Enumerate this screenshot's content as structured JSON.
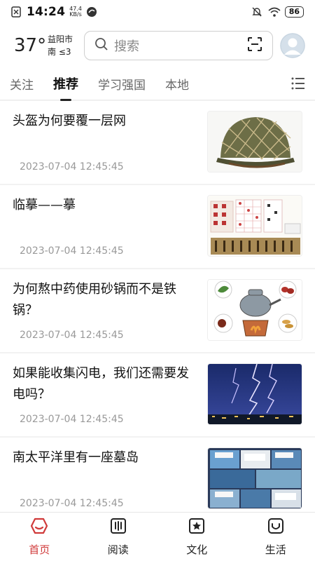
{
  "status_bar": {
    "time": "14:24",
    "net_speed_value": "47.4",
    "net_speed_unit": "KB/s",
    "battery": "86"
  },
  "header": {
    "temperature": "37°",
    "city": "益阳市",
    "wind": "南  ≤3",
    "search_placeholder": "搜索"
  },
  "tabs": [
    {
      "label": "关注"
    },
    {
      "label": "推荐"
    },
    {
      "label": "学习强国"
    },
    {
      "label": "本地"
    }
  ],
  "articles": [
    {
      "title": "头盔为何要覆一层网",
      "date": "2023-07-04 12:45:45"
    },
    {
      "title": "临摹——摹",
      "date": "2023-07-04 12:45:45"
    },
    {
      "title": "为何熬中药使用砂锅而不是铁锅？",
      "date": "2023-07-04 12:45:45"
    },
    {
      "title": "如果能收集闪电，我们还需要发电吗？",
      "date": "2023-07-04 12:45:45"
    },
    {
      "title": "南太平洋里有一座墓岛",
      "date": "2023-07-04 12:45:45"
    }
  ],
  "bottom_nav": [
    {
      "label": "首页",
      "icon": "home-icon"
    },
    {
      "label": "阅读",
      "icon": "book-icon"
    },
    {
      "label": "文化",
      "icon": "culture-icon"
    },
    {
      "label": "生活",
      "icon": "life-icon"
    }
  ],
  "colors": {
    "accent": "#d03a3a"
  }
}
